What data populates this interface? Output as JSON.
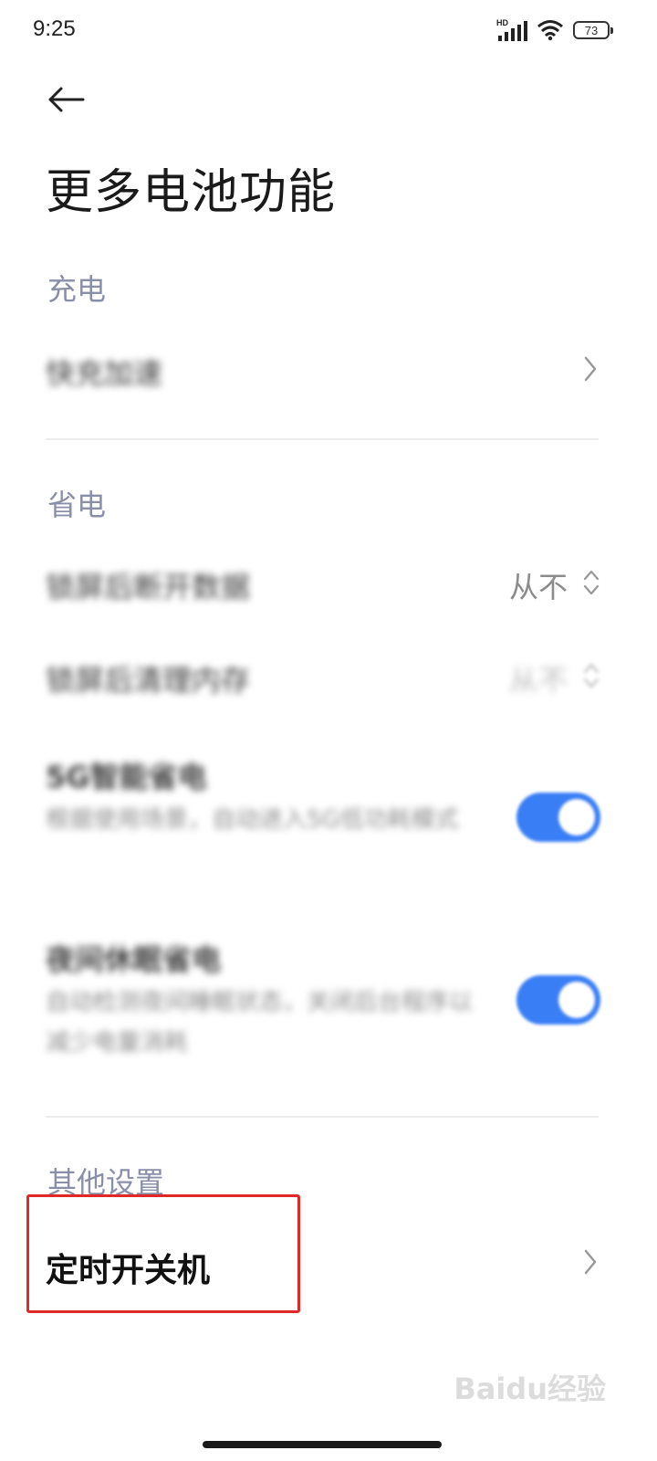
{
  "status_bar": {
    "time": "9:25",
    "network_badge": "HD",
    "battery_level": "73"
  },
  "header": {
    "title": "更多电池功能"
  },
  "sections": {
    "charging": {
      "header": "充电",
      "items": [
        {
          "label": "快充加速"
        }
      ]
    },
    "power_saving": {
      "header": "省电",
      "items": [
        {
          "label": "锁屏后断开数据",
          "value": "从不"
        },
        {
          "label": "锁屏后清理内存",
          "value": "从不"
        },
        {
          "label": "5G智能省电",
          "subtitle": "根据使用场景，自动进入5G低功耗模式",
          "enabled": true
        },
        {
          "label": "夜间休眠省电",
          "subtitle": "自动检测夜间睡眠状态，关闭后台程序以减少电量消耗",
          "enabled": true
        }
      ]
    },
    "other": {
      "header": "其他设置",
      "items": [
        {
          "label": "定时开关机"
        }
      ]
    }
  },
  "watermark": "Baidu经验",
  "colors": {
    "accent": "#3a7ef5",
    "section_header": "#8a8fa8",
    "highlight": "#e02828"
  },
  "icons": [
    "signal-icon",
    "wifi-icon",
    "battery-icon",
    "back-arrow-icon",
    "chevron-right-icon",
    "spinner-updown-icon"
  ]
}
